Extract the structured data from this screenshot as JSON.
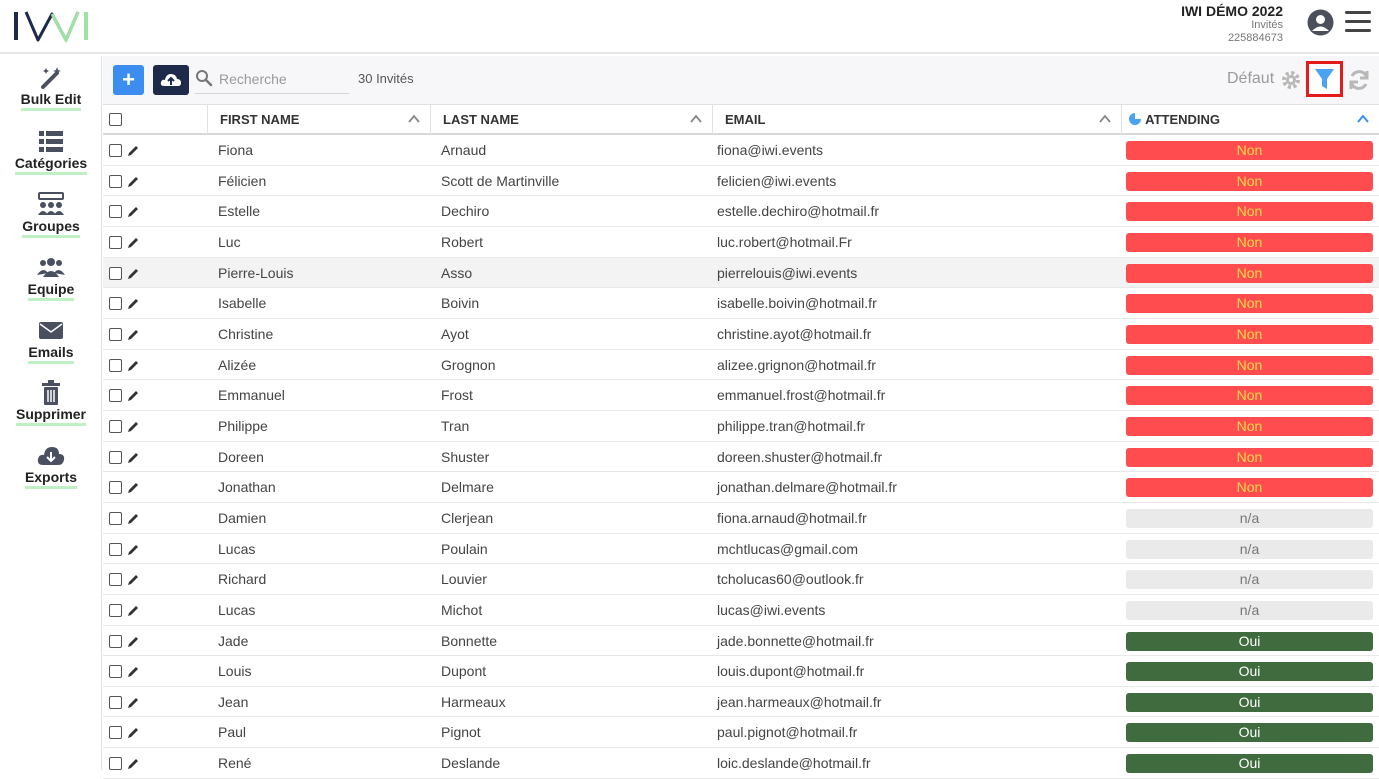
{
  "app": {
    "logo_text": "IWI"
  },
  "event": {
    "title": "IWI DÉMO 2022",
    "section": "Invités",
    "id": "225884673"
  },
  "sidebar": {
    "items": [
      {
        "label": "Bulk Edit",
        "icon": "magic-wand-icon"
      },
      {
        "label": "Catégories",
        "icon": "list-icon"
      },
      {
        "label": "Groupes",
        "icon": "groups-icon"
      },
      {
        "label": "Equipe",
        "icon": "team-icon"
      },
      {
        "label": "Emails",
        "icon": "envelope-icon"
      },
      {
        "label": "Supprimer",
        "icon": "trash-icon"
      },
      {
        "label": "Exports",
        "icon": "cloud-download-icon"
      }
    ]
  },
  "toolbar": {
    "add_label": "+",
    "search_placeholder": "Recherche",
    "count_label": "30 Invités",
    "view_label": "Défaut"
  },
  "table": {
    "columns": [
      "FIRST NAME",
      "LAST NAME",
      "EMAIL",
      "ATTENDING"
    ],
    "rows": [
      {
        "first": "Fiona",
        "last": "Arnaud",
        "email": "fiona@iwi.events",
        "attending": "Non"
      },
      {
        "first": "Félicien",
        "last": "Scott de Martinville",
        "email": "felicien@iwi.events",
        "attending": "Non"
      },
      {
        "first": "Estelle",
        "last": "Dechiro",
        "email": "estelle.dechiro@hotmail.fr",
        "attending": "Non"
      },
      {
        "first": "Luc",
        "last": "Robert",
        "email": "luc.robert@hotmail.Fr",
        "attending": "Non"
      },
      {
        "first": "Pierre-Louis",
        "last": "Asso",
        "email": "pierrelouis@iwi.events",
        "attending": "Non"
      },
      {
        "first": "Isabelle",
        "last": "Boivin",
        "email": "isabelle.boivin@hotmail.fr",
        "attending": "Non"
      },
      {
        "first": "Christine",
        "last": "Ayot",
        "email": "christine.ayot@hotmail.fr",
        "attending": "Non"
      },
      {
        "first": "Alizée",
        "last": "Grognon",
        "email": "alizee.grignon@hotmail.fr",
        "attending": "Non"
      },
      {
        "first": "Emmanuel",
        "last": "Frost",
        "email": "emmanuel.frost@hotmail.fr",
        "attending": "Non"
      },
      {
        "first": "Philippe",
        "last": "Tran",
        "email": "philippe.tran@hotmail.fr",
        "attending": "Non"
      },
      {
        "first": "Doreen",
        "last": "Shuster",
        "email": "doreen.shuster@hotmail.fr",
        "attending": "Non"
      },
      {
        "first": "Jonathan",
        "last": "Delmare",
        "email": "jonathan.delmare@hotmail.fr",
        "attending": "Non"
      },
      {
        "first": "Damien",
        "last": "Clerjean",
        "email": "fiona.arnaud@hotmail.fr",
        "attending": "n/a"
      },
      {
        "first": "Lucas",
        "last": "Poulain",
        "email": "mchtlucas@gmail.com",
        "attending": "n/a"
      },
      {
        "first": "Richard",
        "last": "Louvier",
        "email": "tcholucas60@outlook.fr",
        "attending": "n/a"
      },
      {
        "first": "Lucas",
        "last": "Michot",
        "email": "lucas@iwi.events",
        "attending": "n/a"
      },
      {
        "first": "Jade",
        "last": "Bonnette",
        "email": "jade.bonnette@hotmail.fr",
        "attending": "Oui"
      },
      {
        "first": "Louis",
        "last": "Dupont",
        "email": "louis.dupont@hotmail.fr",
        "attending": "Oui"
      },
      {
        "first": "Jean",
        "last": "Harmeaux",
        "email": "jean.harmeaux@hotmail.fr",
        "attending": "Oui"
      },
      {
        "first": "Paul",
        "last": "Pignot",
        "email": "paul.pignot@hotmail.fr",
        "attending": "Oui"
      },
      {
        "first": "René",
        "last": "Deslande",
        "email": "loic.deslande@hotmail.fr",
        "attending": "Oui"
      }
    ]
  },
  "status_colors": {
    "Non": {
      "bg": "#ff4d4f",
      "fg": "#ffd84a"
    },
    "n/a": {
      "bg": "#eaeaea",
      "fg": "#777777"
    },
    "Oui": {
      "bg": "#3f6b3f",
      "fg": "#ffffff"
    }
  },
  "colors": {
    "accent": "#3b8ef0",
    "sidebar_underline": "#bff0c4",
    "filter_highlight": "#e41b1b"
  }
}
